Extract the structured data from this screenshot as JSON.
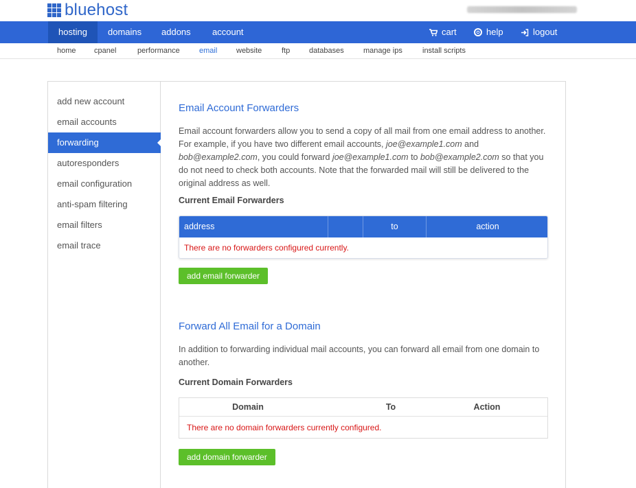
{
  "brand": {
    "name": "bluehost",
    "color": "#2f66c9"
  },
  "main_nav": {
    "left": [
      "hosting",
      "domains",
      "addons",
      "account"
    ],
    "active": "hosting",
    "cart": "cart",
    "help": "help",
    "logout": "logout"
  },
  "sub_nav": {
    "items": [
      "home",
      "cpanel",
      "performance",
      "email",
      "website",
      "ftp",
      "databases",
      "manage ips",
      "install scripts"
    ],
    "active": "email"
  },
  "sidebar": {
    "items": [
      "add new account",
      "email accounts",
      "forwarding",
      "autoresponders",
      "email configuration",
      "anti-spam filtering",
      "email filters",
      "email trace"
    ],
    "active": "forwarding"
  },
  "forwarders": {
    "title": "Email Account Forwarders",
    "desc_1": "Email account forwarders allow you to send a copy of all mail from one email address to another. For example, if you have two different email accounts, ",
    "email_a": "joe@example1.com",
    "desc_2": " and ",
    "email_b": "bob@example2.com",
    "desc_3": ", you could forward ",
    "email_c": "joe@example1.com",
    "desc_4": " to ",
    "email_d": "bob@example2.com",
    "desc_5": " so that you do not need to check both accounts. Note that the forwarded mail will still be delivered to the original address as well.",
    "current_heading": "Current Email Forwarders",
    "columns": [
      "address",
      "to",
      "action"
    ],
    "empty_message": "There are no forwarders configured currently.",
    "add_button": "add email forwarder"
  },
  "domain_forward": {
    "title": "Forward All Email for a Domain",
    "desc": "In addition to forwarding individual mail accounts, you can forward all email from one domain to another.",
    "current_heading": "Current Domain Forwarders",
    "columns": [
      "Domain",
      "To",
      "Action"
    ],
    "empty_message": "There are no domain forwarders currently configured.",
    "add_button": "add domain forwarder"
  },
  "colors": {
    "nav_blue": "#2e66d6",
    "nav_active": "#1f54b7",
    "button_green": "#5cbf2a",
    "error_red": "#d81515"
  }
}
